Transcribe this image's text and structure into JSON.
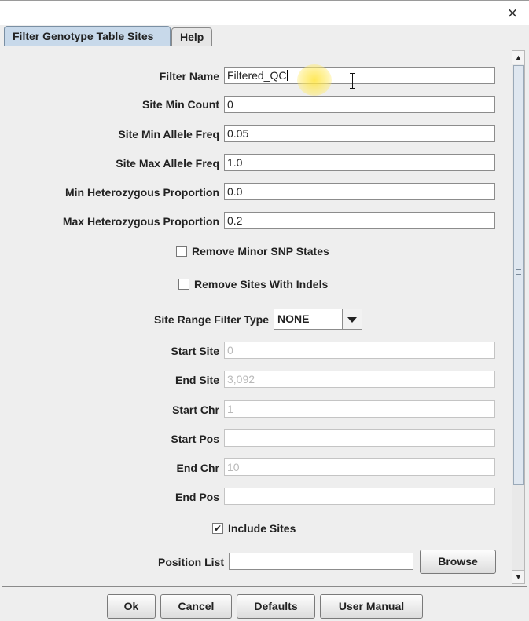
{
  "window": {
    "close_glyph": "×"
  },
  "tabs": [
    {
      "label": "Filter Genotype Table Sites",
      "active": true
    },
    {
      "label": "Help",
      "active": false
    }
  ],
  "form": {
    "filter_name": {
      "label": "Filter Name",
      "value": "Filtered_QC"
    },
    "site_min_count": {
      "label": "Site Min Count",
      "value": "0"
    },
    "site_min_allele_freq": {
      "label": "Site Min Allele Freq",
      "value": "0.05"
    },
    "site_max_allele_freq": {
      "label": "Site Max Allele Freq",
      "value": "1.0"
    },
    "min_het_prop": {
      "label": "Min Heterozygous Proportion",
      "value": "0.0"
    },
    "max_het_prop": {
      "label": "Max Heterozygous Proportion",
      "value": "0.2"
    },
    "remove_minor_snp": {
      "label": "Remove Minor SNP States",
      "checked": false
    },
    "remove_indels": {
      "label": "Remove Sites With Indels",
      "checked": false
    },
    "range_filter_type": {
      "label": "Site Range Filter Type",
      "value": "NONE"
    },
    "start_site": {
      "label": "Start Site",
      "placeholder": "0"
    },
    "end_site": {
      "label": "End Site",
      "placeholder": "3,092"
    },
    "start_chr": {
      "label": "Start Chr",
      "placeholder": "1"
    },
    "start_pos": {
      "label": "Start Pos",
      "placeholder": ""
    },
    "end_chr": {
      "label": "End Chr",
      "placeholder": "10"
    },
    "end_pos": {
      "label": "End Pos",
      "placeholder": ""
    },
    "include_sites": {
      "label": "Include Sites",
      "checked": true,
      "check_glyph": "✔"
    },
    "position_list": {
      "label": "Position List",
      "value": ""
    }
  },
  "buttons": {
    "browse": "Browse",
    "ok": "Ok",
    "cancel": "Cancel",
    "defaults": "Defaults",
    "user_manual": "User Manual"
  },
  "scrollbar": {
    "up_glyph": "▲",
    "down_glyph": "▼"
  },
  "colors": {
    "active_tab": "#c8d9ea",
    "cursor_highlight": "#ffe43c"
  }
}
